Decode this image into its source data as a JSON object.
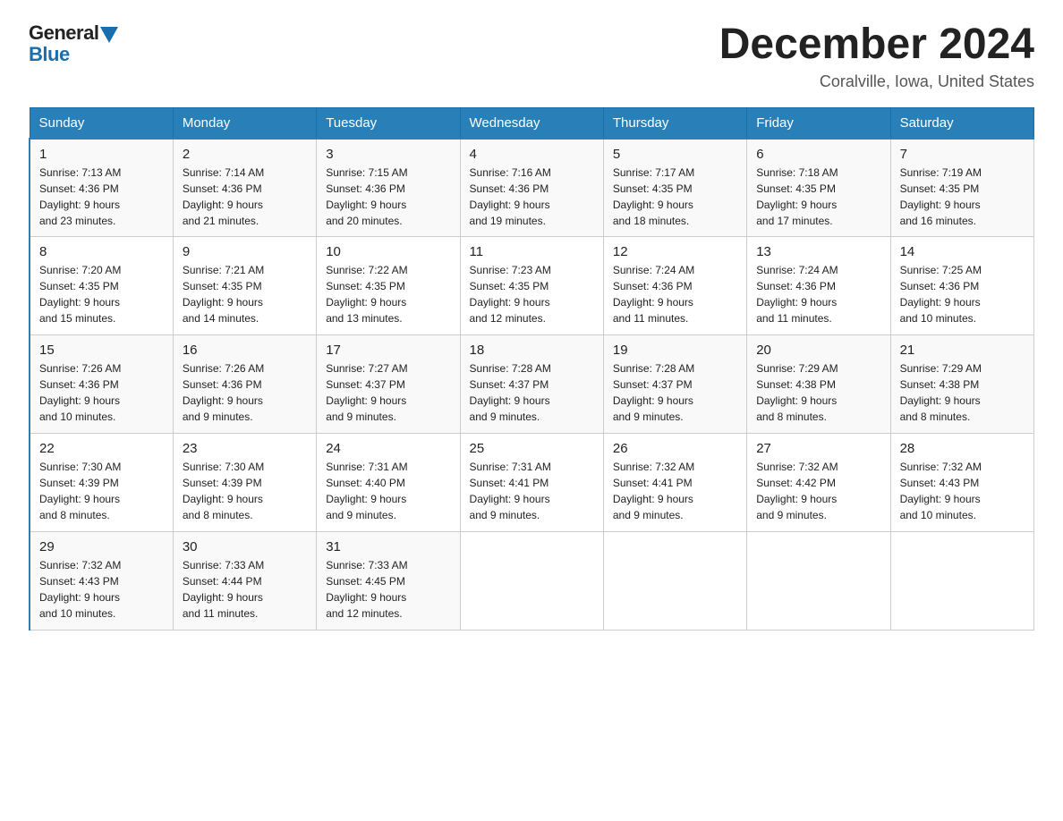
{
  "header": {
    "logo_general": "General",
    "logo_blue": "Blue",
    "month_title": "December 2024",
    "location": "Coralville, Iowa, United States"
  },
  "weekdays": [
    "Sunday",
    "Monday",
    "Tuesday",
    "Wednesday",
    "Thursday",
    "Friday",
    "Saturday"
  ],
  "weeks": [
    [
      {
        "day": "1",
        "sunrise": "7:13 AM",
        "sunset": "4:36 PM",
        "daylight": "9 hours and 23 minutes."
      },
      {
        "day": "2",
        "sunrise": "7:14 AM",
        "sunset": "4:36 PM",
        "daylight": "9 hours and 21 minutes."
      },
      {
        "day": "3",
        "sunrise": "7:15 AM",
        "sunset": "4:36 PM",
        "daylight": "9 hours and 20 minutes."
      },
      {
        "day": "4",
        "sunrise": "7:16 AM",
        "sunset": "4:36 PM",
        "daylight": "9 hours and 19 minutes."
      },
      {
        "day": "5",
        "sunrise": "7:17 AM",
        "sunset": "4:35 PM",
        "daylight": "9 hours and 18 minutes."
      },
      {
        "day": "6",
        "sunrise": "7:18 AM",
        "sunset": "4:35 PM",
        "daylight": "9 hours and 17 minutes."
      },
      {
        "day": "7",
        "sunrise": "7:19 AM",
        "sunset": "4:35 PM",
        "daylight": "9 hours and 16 minutes."
      }
    ],
    [
      {
        "day": "8",
        "sunrise": "7:20 AM",
        "sunset": "4:35 PM",
        "daylight": "9 hours and 15 minutes."
      },
      {
        "day": "9",
        "sunrise": "7:21 AM",
        "sunset": "4:35 PM",
        "daylight": "9 hours and 14 minutes."
      },
      {
        "day": "10",
        "sunrise": "7:22 AM",
        "sunset": "4:35 PM",
        "daylight": "9 hours and 13 minutes."
      },
      {
        "day": "11",
        "sunrise": "7:23 AM",
        "sunset": "4:35 PM",
        "daylight": "9 hours and 12 minutes."
      },
      {
        "day": "12",
        "sunrise": "7:24 AM",
        "sunset": "4:36 PM",
        "daylight": "9 hours and 11 minutes."
      },
      {
        "day": "13",
        "sunrise": "7:24 AM",
        "sunset": "4:36 PM",
        "daylight": "9 hours and 11 minutes."
      },
      {
        "day": "14",
        "sunrise": "7:25 AM",
        "sunset": "4:36 PM",
        "daylight": "9 hours and 10 minutes."
      }
    ],
    [
      {
        "day": "15",
        "sunrise": "7:26 AM",
        "sunset": "4:36 PM",
        "daylight": "9 hours and 10 minutes."
      },
      {
        "day": "16",
        "sunrise": "7:26 AM",
        "sunset": "4:36 PM",
        "daylight": "9 hours and 9 minutes."
      },
      {
        "day": "17",
        "sunrise": "7:27 AM",
        "sunset": "4:37 PM",
        "daylight": "9 hours and 9 minutes."
      },
      {
        "day": "18",
        "sunrise": "7:28 AM",
        "sunset": "4:37 PM",
        "daylight": "9 hours and 9 minutes."
      },
      {
        "day": "19",
        "sunrise": "7:28 AM",
        "sunset": "4:37 PM",
        "daylight": "9 hours and 9 minutes."
      },
      {
        "day": "20",
        "sunrise": "7:29 AM",
        "sunset": "4:38 PM",
        "daylight": "9 hours and 8 minutes."
      },
      {
        "day": "21",
        "sunrise": "7:29 AM",
        "sunset": "4:38 PM",
        "daylight": "9 hours and 8 minutes."
      }
    ],
    [
      {
        "day": "22",
        "sunrise": "7:30 AM",
        "sunset": "4:39 PM",
        "daylight": "9 hours and 8 minutes."
      },
      {
        "day": "23",
        "sunrise": "7:30 AM",
        "sunset": "4:39 PM",
        "daylight": "9 hours and 8 minutes."
      },
      {
        "day": "24",
        "sunrise": "7:31 AM",
        "sunset": "4:40 PM",
        "daylight": "9 hours and 9 minutes."
      },
      {
        "day": "25",
        "sunrise": "7:31 AM",
        "sunset": "4:41 PM",
        "daylight": "9 hours and 9 minutes."
      },
      {
        "day": "26",
        "sunrise": "7:32 AM",
        "sunset": "4:41 PM",
        "daylight": "9 hours and 9 minutes."
      },
      {
        "day": "27",
        "sunrise": "7:32 AM",
        "sunset": "4:42 PM",
        "daylight": "9 hours and 9 minutes."
      },
      {
        "day": "28",
        "sunrise": "7:32 AM",
        "sunset": "4:43 PM",
        "daylight": "9 hours and 10 minutes."
      }
    ],
    [
      {
        "day": "29",
        "sunrise": "7:32 AM",
        "sunset": "4:43 PM",
        "daylight": "9 hours and 10 minutes."
      },
      {
        "day": "30",
        "sunrise": "7:33 AM",
        "sunset": "4:44 PM",
        "daylight": "9 hours and 11 minutes."
      },
      {
        "day": "31",
        "sunrise": "7:33 AM",
        "sunset": "4:45 PM",
        "daylight": "9 hours and 12 minutes."
      },
      null,
      null,
      null,
      null
    ]
  ],
  "labels": {
    "sunrise": "Sunrise:",
    "sunset": "Sunset:",
    "daylight": "Daylight:"
  }
}
